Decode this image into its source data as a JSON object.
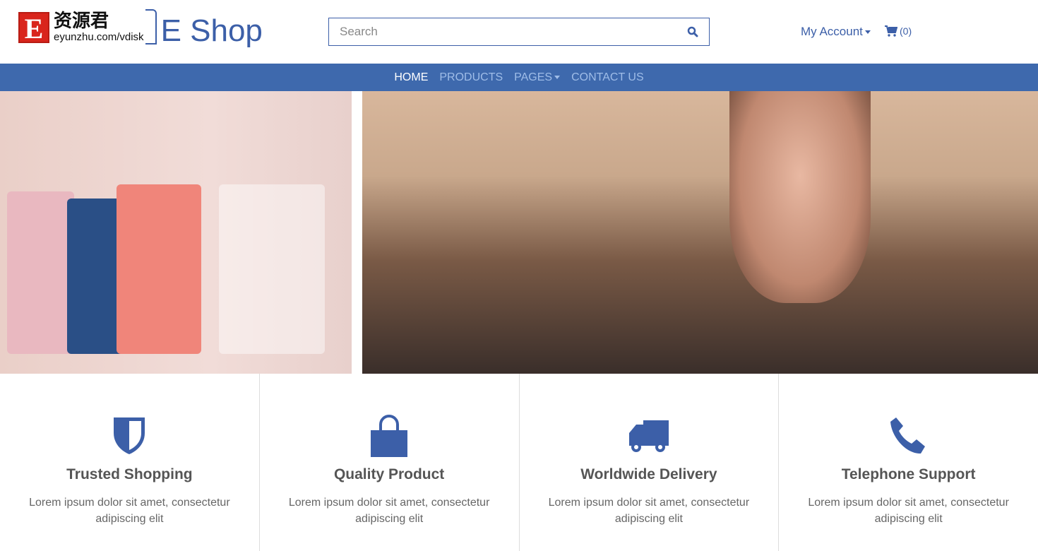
{
  "logo": {
    "letter": "E",
    "chinese": "资源君",
    "url": "eyunzhu.com/vdisk",
    "shop": "E Shop"
  },
  "search": {
    "placeholder": "Search"
  },
  "header": {
    "account_label": "My Account",
    "cart_count": "(0)"
  },
  "nav": {
    "items": [
      {
        "label": "HOME"
      },
      {
        "label": "PRODUCTS"
      },
      {
        "label": "PAGES"
      },
      {
        "label": "CONTACT US"
      }
    ]
  },
  "features": [
    {
      "icon": "shield-icon",
      "title": "Trusted Shopping",
      "text": "Lorem ipsum dolor sit amet, consectetur adipiscing elit"
    },
    {
      "icon": "shopping-bag-icon",
      "title": "Quality Product",
      "text": "Lorem ipsum dolor sit amet, consectetur adipiscing elit"
    },
    {
      "icon": "truck-icon",
      "title": "Worldwide Delivery",
      "text": "Lorem ipsum dolor sit amet, consectetur adipiscing elit"
    },
    {
      "icon": "phone-icon",
      "title": "Telephone Support",
      "text": "Lorem ipsum dolor sit amet, consectetur adipiscing elit"
    }
  ],
  "colors": {
    "brand": "#3c5fa8",
    "nav_bg": "#3e69ad"
  }
}
